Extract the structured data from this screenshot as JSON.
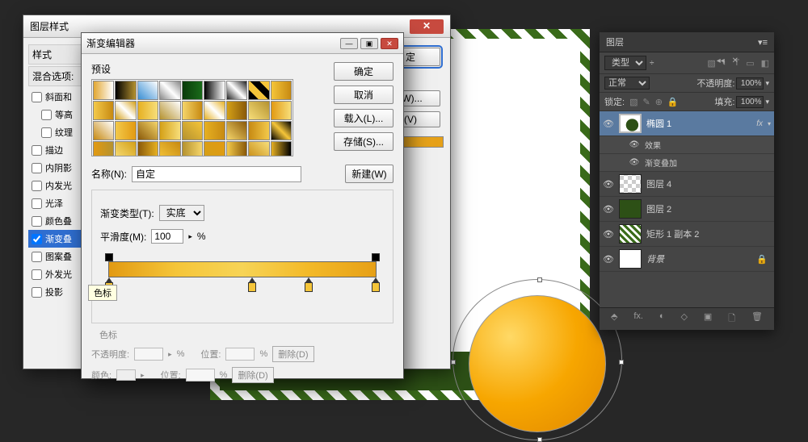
{
  "canvas": {},
  "layers_panel": {
    "tab": "图层",
    "menu_icons": [
      "◂◂",
      "✕"
    ],
    "filter_label": "类型",
    "filter_icons": [
      "▧",
      "◐",
      "T",
      "▭",
      "◧"
    ],
    "blend_mode": "正常",
    "opacity_label": "不透明度:",
    "opacity_value": "100%",
    "lock_label": "锁定:",
    "lock_icons": [
      "▧",
      "✎",
      "⊕",
      "🔒"
    ],
    "fill_label": "填充:",
    "fill_value": "100%",
    "layers": [
      {
        "vis": "👁",
        "name": "椭圆 1",
        "fx": "fx",
        "selected": true,
        "thumb": "shape-green"
      },
      {
        "sub": true,
        "name": "效果"
      },
      {
        "sub": true,
        "name": "渐变叠加"
      },
      {
        "vis": "👁",
        "name": "图层 4",
        "thumb": "checker"
      },
      {
        "vis": "👁",
        "name": "图层 2",
        "thumb": "green"
      },
      {
        "vis": "👁",
        "name": "矩形 1 副本 2",
        "thumb": "striped"
      },
      {
        "vis": "👁",
        "name": "背景",
        "thumb": "white",
        "locked": true,
        "italic": true
      }
    ],
    "footer_icons": [
      "⬘",
      "fx.",
      "◐",
      "◇",
      "▣",
      "🗋",
      "🗑"
    ]
  },
  "style_dialog": {
    "title": "图层样式",
    "styles_header": "样式",
    "blend_header": "混合选项:",
    "items": [
      {
        "label": "斜面和",
        "checked": false
      },
      {
        "label": "等高",
        "checked": false,
        "indent": true
      },
      {
        "label": "纹理",
        "checked": false,
        "indent": true
      },
      {
        "label": "描边",
        "checked": false
      },
      {
        "label": "内阴影",
        "checked": false
      },
      {
        "label": "内发光",
        "checked": false
      },
      {
        "label": "光泽",
        "checked": false
      },
      {
        "label": "颜色叠",
        "checked": false
      },
      {
        "label": "渐变叠",
        "checked": true,
        "selected": true
      },
      {
        "label": "图案叠",
        "checked": false
      },
      {
        "label": "外发光",
        "checked": false
      },
      {
        "label": "投影",
        "checked": false
      }
    ],
    "btn_ok": "定",
    "suffix_w": "(W)...",
    "suffix_v": "(V)"
  },
  "gradient_editor": {
    "title": "渐变编辑器",
    "presets_label": "预设",
    "btn_ok": "确定",
    "btn_cancel": "取消",
    "btn_load": "载入(L)...",
    "btn_save": "存储(S)...",
    "name_label": "名称(N):",
    "name_value": "自定",
    "btn_new": "新建(W)",
    "type_label": "渐变类型(T):",
    "type_value": "实底",
    "smooth_label": "平滑度(M):",
    "smooth_value": "100",
    "smooth_unit": "%",
    "stops_section": "色标",
    "opacity_label": "不透明度:",
    "position_label": "位置:",
    "color_label": "颜色:",
    "delete_btn": "删除(D)",
    "pct": "%",
    "tooltip": "色标",
    "preset_gradients": [
      "linear-gradient(90deg,#e2a732,#fff)",
      "linear-gradient(90deg,#000,#b5922f)",
      "linear-gradient(45deg,#3a8fd4,#fff)",
      "linear-gradient(45deg,#888,#fff,#888)",
      "linear-gradient(90deg,#0a3b0a,#1a6b1a)",
      "linear-gradient(90deg,#000,#fff)",
      "linear-gradient(45deg,#222,#fff,#222)",
      "linear-gradient(45deg,#000 25%,#f5c539 25% 50%,#000 50% 75%,#f5c539 75%)",
      "linear-gradient(90deg,#f5c539,#c78a12)",
      "linear-gradient(90deg,#f3c94a,#c78a12)",
      "linear-gradient(45deg,#d4a017,#fff,#d4a017)",
      "linear-gradient(90deg,#e6b022,#f7de7a)",
      "linear-gradient(45deg,#b5922f,#fff)",
      "linear-gradient(90deg,#f5d56a,#c78a12)",
      "linear-gradient(45deg,#e6b022,#fff,#e6b022)",
      "linear-gradient(90deg,#d4a017,#8a5a0a)",
      "linear-gradient(45deg,#f7de7a,#b5922f)",
      "linear-gradient(90deg,#e29a12,#f7de7a)",
      "linear-gradient(45deg,#c78a12,#fff)",
      "linear-gradient(90deg,#f3c94a,#e29a12)",
      "linear-gradient(45deg,#8a5a0a,#f5d56a)",
      "linear-gradient(90deg,#d4a017,#f7de7a)",
      "linear-gradient(45deg,#b5922f,#f5c539)",
      "linear-gradient(90deg,#e6b022,#c78a12)",
      "linear-gradient(45deg,#f5d56a,#8a5a0a)",
      "linear-gradient(90deg,#c78a12,#f3c94a)",
      "linear-gradient(45deg,#000,#f5c539,#000)",
      "linear-gradient(90deg,#e29a12,#b5922f)",
      "linear-gradient(45deg,#f7de7a,#d4a017)",
      "linear-gradient(90deg,#8a5a0a,#e6b022)",
      "linear-gradient(45deg,#f5c539,#c78a12)",
      "linear-gradient(90deg,#b5922f,#f5d56a)",
      "linear-gradient(45deg,#d4a017,#e29a12)",
      "linear-gradient(90deg,#f3c94a,#8a5a0a)",
      "linear-gradient(45deg,#c78a12,#f7de7a)",
      "linear-gradient(90deg,#e6b022,#000)"
    ]
  }
}
